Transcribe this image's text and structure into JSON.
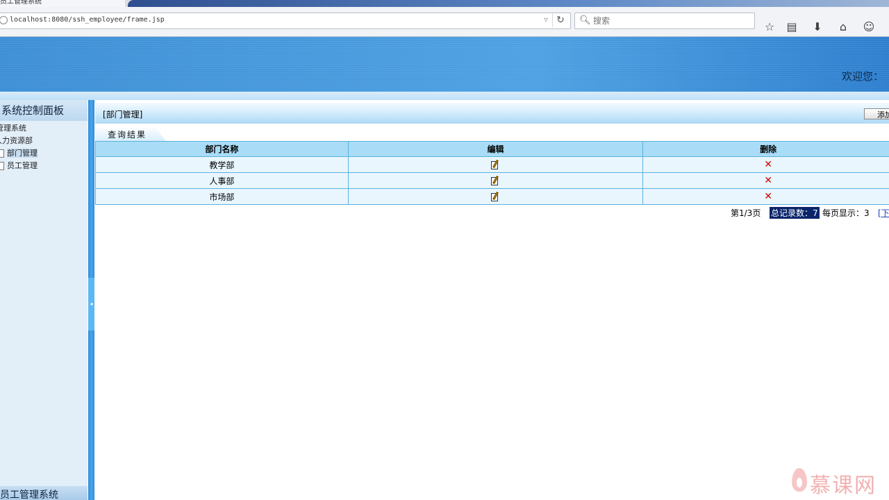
{
  "browser": {
    "tab_title": "员工管理系统",
    "url": "localhost:8080/ssh_employee/frame.jsp",
    "search_placeholder": "搜索"
  },
  "header": {
    "welcome": "欢迎您："
  },
  "sidebar": {
    "title": "系统控制面板",
    "tree": [
      {
        "label": "管理系统",
        "level": 0
      },
      {
        "label": "人力资源部",
        "level": 1
      },
      {
        "label": "部门管理",
        "level": 2,
        "selected": true
      },
      {
        "label": "员工管理",
        "level": 2,
        "selected": false
      }
    ],
    "footer": "员工管理系统"
  },
  "main": {
    "title": "[部门管理]",
    "add_button": "添加",
    "result_tab": "查询结果",
    "columns": [
      "部门名称",
      "编辑",
      "删除"
    ],
    "rows": [
      {
        "name": "教学部"
      },
      {
        "name": "人事部"
      },
      {
        "name": "市场部"
      }
    ],
    "pager": {
      "page": "第1/3页",
      "total": "总记录数：7",
      "per_page": "每页显示：3",
      "next": "[下一页]"
    }
  },
  "watermark": "慕课网",
  "icons": {
    "edit": "edit-icon",
    "delete": "delete-icon"
  },
  "colors": {
    "header_blue": "#3e8fd6",
    "table_header": "#a9dcf6",
    "table_row": "#e9f6fe",
    "delete_red": "#d40000",
    "highlight": "#0a246a"
  }
}
